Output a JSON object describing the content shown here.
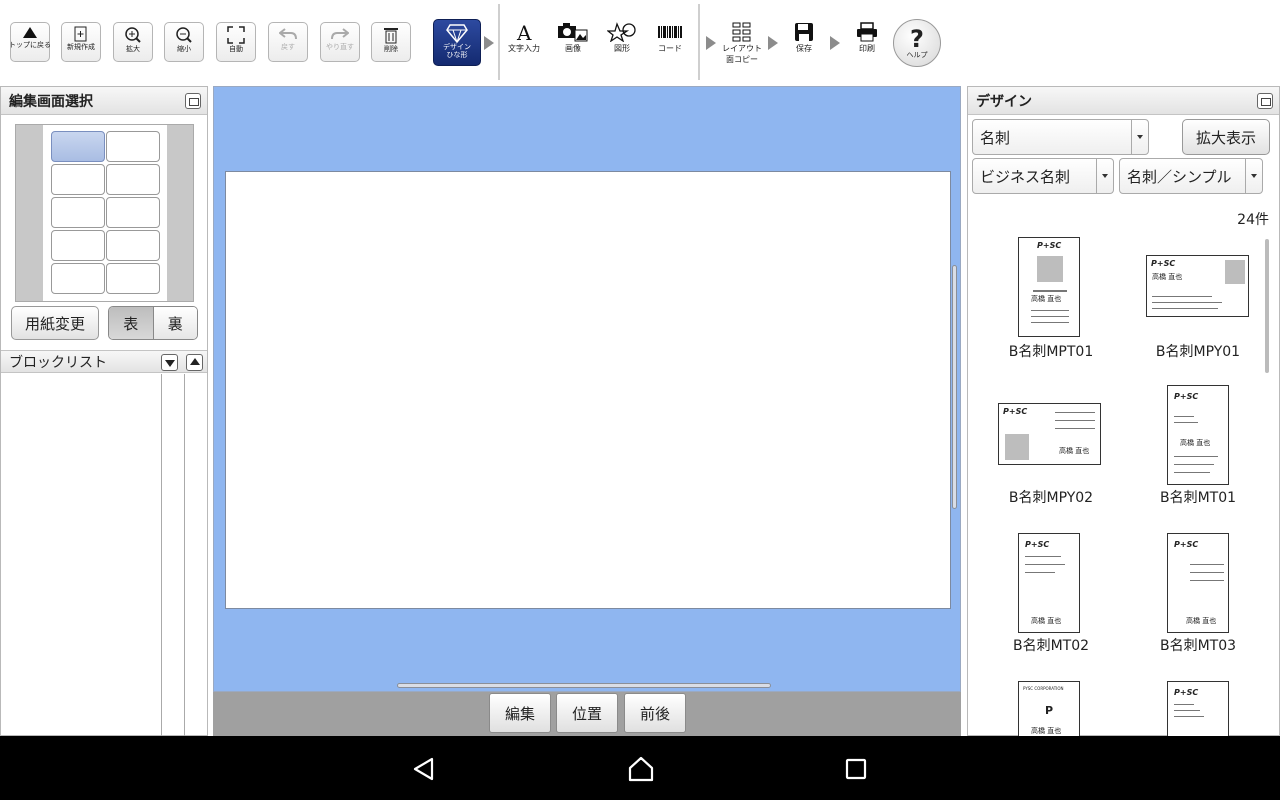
{
  "toolbar": {
    "top_back": "トップに戻る",
    "new": "新規作成",
    "zoom_in": "拡大",
    "zoom_out": "縮小",
    "auto": "自動",
    "undo": "戻す",
    "redo": "やり直す",
    "delete": "削除",
    "design_line1": "デザイン",
    "design_line2": "ひな形",
    "text_input": "文字入力",
    "image": "画像",
    "shape": "図形",
    "code": "コード",
    "layout_line1": "レイアウト",
    "layout_line2": "面コピー",
    "save": "保存",
    "print": "印刷",
    "help": "ヘルプ",
    "help_glyph": "?"
  },
  "left_panel": {
    "title": "編集画面選択",
    "paper_change": "用紙変更",
    "side_front": "表",
    "side_back": "裏",
    "block_list_title": "ブロックリスト"
  },
  "bottom_bar": {
    "edit": "編集",
    "position": "位置",
    "order": "前後"
  },
  "right_panel": {
    "title": "デザイン",
    "category": "名刺",
    "zoom_display": "拡大表示",
    "subcategory": "ビジネス名刺",
    "style": "名刺／シンプル",
    "count": "24件",
    "templates": [
      {
        "name": "B名刺MPT01"
      },
      {
        "name": "B名刺MPY01"
      },
      {
        "name": "B名刺MPY02"
      },
      {
        "name": "B名刺MT01"
      },
      {
        "name": "B名刺MT02"
      },
      {
        "name": "B名刺MT03"
      },
      {
        "name": ""
      },
      {
        "name": ""
      }
    ],
    "thumb_texts": {
      "logo": "P+SC",
      "logo_p": "P",
      "person": "高橋 直也",
      "corp": "PYSC CORPORATION"
    }
  },
  "colors": {
    "canvas_bg": "#8fb6f0",
    "design_btn": "#1c3482",
    "nav_bar": "#000000"
  }
}
